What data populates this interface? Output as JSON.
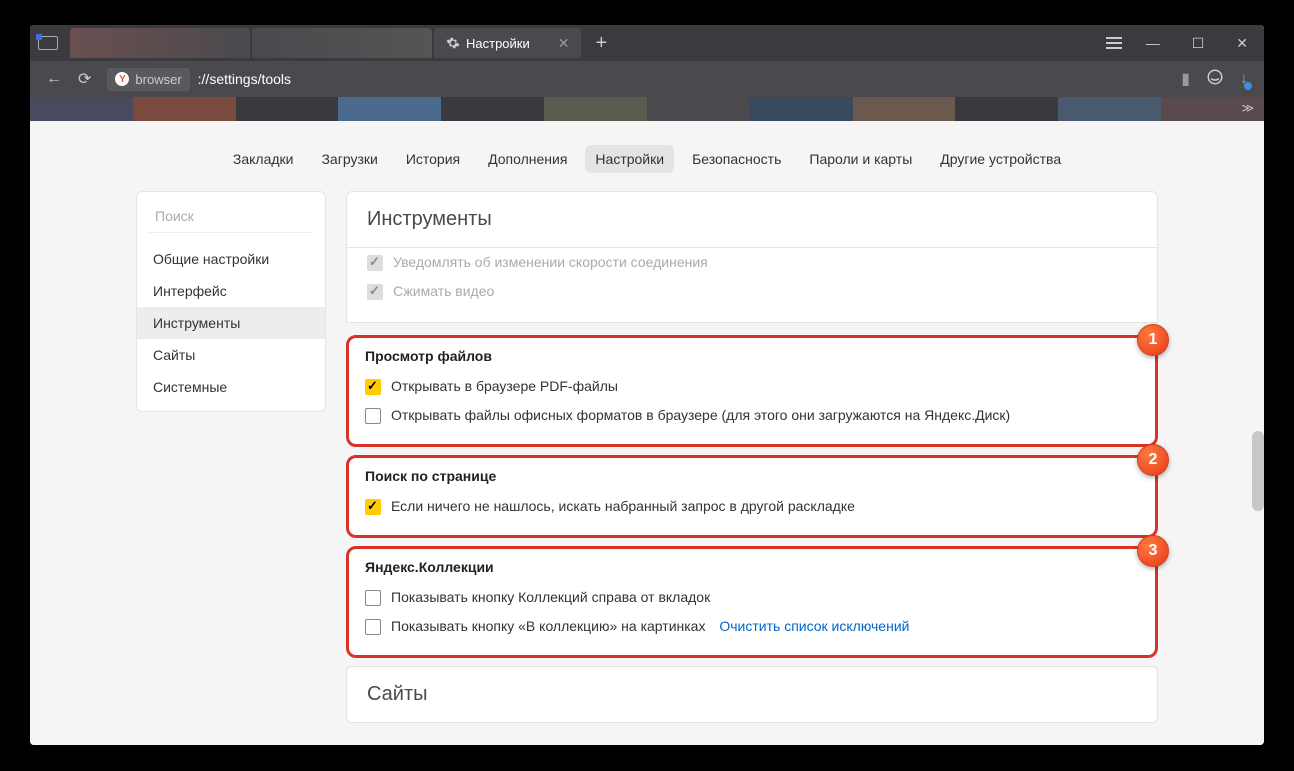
{
  "tab": {
    "title": "Настройки"
  },
  "url": {
    "protocol": "browser",
    "path": "://settings/tools"
  },
  "topnav": {
    "items": [
      "Закладки",
      "Загрузки",
      "История",
      "Дополнения",
      "Настройки",
      "Безопасность",
      "Пароли и карты",
      "Другие устройства"
    ],
    "active_index": 4
  },
  "sidebar": {
    "search_placeholder": "Поиск",
    "items": [
      "Общие настройки",
      "Интерфейс",
      "Инструменты",
      "Сайты",
      "Системные"
    ],
    "active_index": 2
  },
  "sections": {
    "tools_title": "Инструменты",
    "disabled_opts": [
      "Уведомлять об изменении скорости соединения",
      "Сжимать видео"
    ],
    "file_view": {
      "title": "Просмотр файлов",
      "opt_pdf": "Открывать в браузере PDF-файлы",
      "opt_office": "Открывать файлы офисных форматов в браузере (для этого они загружаются на Яндекс.Диск)"
    },
    "page_search": {
      "title": "Поиск по странице",
      "opt_layout": "Если ничего не нашлось, искать набранный запрос в другой раскладке"
    },
    "collections": {
      "title": "Яндекс.Коллекции",
      "opt_button_right": "Показывать кнопку Коллекций справа от вкладок",
      "opt_button_images": "Показывать кнопку «В коллекцию» на картинках",
      "clear_link": "Очистить список исключений"
    },
    "sites_title": "Сайты"
  },
  "badges": {
    "b1": "1",
    "b2": "2",
    "b3": "3"
  }
}
